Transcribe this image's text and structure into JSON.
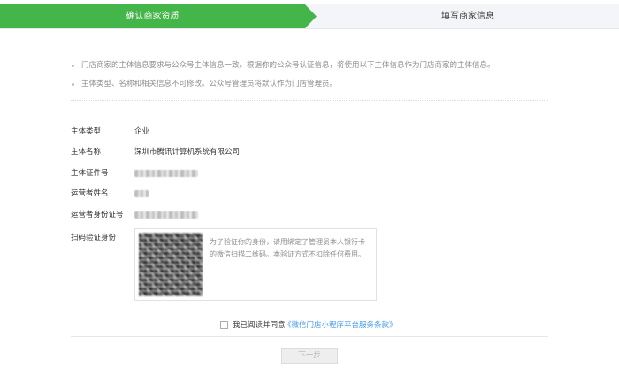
{
  "steps": [
    {
      "label": "确认商家资质",
      "active": true
    },
    {
      "label": "填写商家信息",
      "active": false
    }
  ],
  "notices": [
    "门店商家的主体信息要求与公众号主体信息一致。根据你的公众号认证信息，将使用以下主体信息作为门店商家的主体信息。",
    "主体类型、名称和相关信息不可修改。公众号管理员将默认作为门店管理员。"
  ],
  "fields": {
    "entity_type": {
      "label": "主体类型",
      "value": "企业"
    },
    "entity_name": {
      "label": "主体名称",
      "value": "深圳市腾讯计算机系统有限公司"
    },
    "entity_id": {
      "label": "主体证件号"
    },
    "operator_name": {
      "label": "运营者姓名"
    },
    "operator_id": {
      "label": "运营者身份证号"
    },
    "qr_verify": {
      "label": "扫码验证身份"
    }
  },
  "verify": {
    "instructions": "为了验证你的身份，请用绑定了管理员本人银行卡的微信扫描二维码。本验证方式不扣除任何费用。"
  },
  "agreement": {
    "prefix": "我已阅读并同意",
    "link": "《微信门店小程序平台服务条款》"
  },
  "buttons": {
    "next": "下一步"
  },
  "colors": {
    "accent": "#44b549",
    "link": "#459ae9"
  }
}
